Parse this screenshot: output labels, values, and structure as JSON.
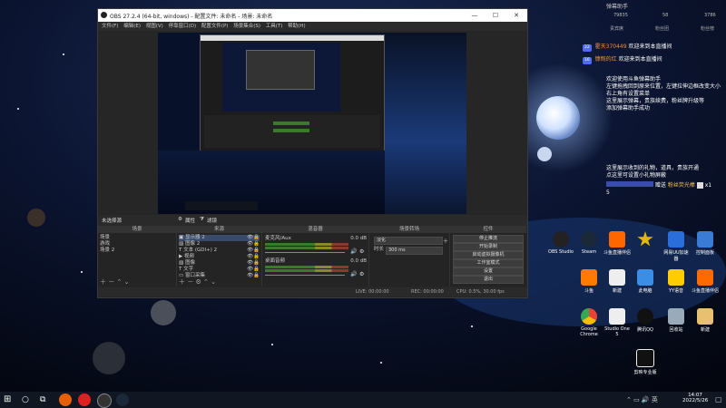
{
  "obs": {
    "title": "OBS 27.2.4 (64-bit, windows) - 配置文件: 未命名 - 场景: 未命名",
    "menu": [
      "文件(F)",
      "编辑(E)",
      "视图(V)",
      "停靠窗口(D)",
      "配置文件(P)",
      "场景集合(S)",
      "工具(T)",
      "帮助(H)"
    ],
    "scene_bar_label": "未选择源",
    "props_button": "属性",
    "filters_button": "滤镜",
    "docks": {
      "scenes": {
        "title": "场景",
        "items": [
          "场景",
          "游戏",
          "场景 2"
        ]
      },
      "sources": {
        "title": "来源",
        "items": [
          "显示器 2",
          "图像 2",
          "文本 (GDI+) 2",
          "视频",
          "图像",
          "文字",
          "窗口采集"
        ]
      },
      "mixer": {
        "title": "混音器",
        "channels": [
          {
            "name": "麦克风/Aux",
            "db": "0.0 dB"
          },
          {
            "name": "桌面音频",
            "db": "0.0 dB"
          }
        ]
      },
      "transitions": {
        "title": "场景转场",
        "type": "淡化",
        "duration_label": "时长",
        "duration_value": "300 ms"
      },
      "controls": {
        "title": "控件",
        "buttons": [
          "停止推流",
          "开始录制",
          "启动虚拟摄像机",
          "工作室模式",
          "设置",
          "退出"
        ]
      }
    },
    "status": {
      "live": "LIVE: 00:00:00",
      "rec": "REC: 00:00:00",
      "cpu": "CPU: 0.5%, 30.00 fps"
    }
  },
  "chat": {
    "stats": [
      "79835",
      "58",
      "3786"
    ],
    "tabs": [
      "贵宾席",
      "粉丝团",
      "粉丝榜"
    ],
    "welcome": [
      {
        "badge": "22",
        "name": "霍天370449",
        "text": "欢迎来到本直播间"
      },
      {
        "badge": "16",
        "name": "慷慨的红",
        "text": "欢迎来到本直播间"
      }
    ],
    "help_lines": [
      "欢迎使用斗鱼弹幕助手",
      "左键拖拽回到原来位置，左键拉伸边框改变大小",
      "右上角有设置菜单",
      "这里展示弹幕，贵族续费，粉丝牌升级等",
      "添加弹幕助手成功"
    ],
    "gift_lines": [
      "这里展示收到的礼物，道具，贵族开通",
      "点这里可设置小礼物屏蔽"
    ],
    "gift_item": {
      "user": "赠送",
      "gift": "粉丝荧光棒",
      "count": "x1"
    },
    "gift_number": "5"
  },
  "desktop_icons": [
    {
      "label": "OBS Studio",
      "color": "#222"
    },
    {
      "label": "Steam",
      "color": "#1b2838"
    },
    {
      "label": "斗鱼直播伴侣",
      "color": "#f60"
    },
    {
      "label": "",
      "color": "#e5b800"
    },
    {
      "label": "网易UU加速器",
      "color": "#2a6edb"
    },
    {
      "label": "控制面板",
      "color": "#3a7bd5"
    },
    {
      "label": "斗鱼",
      "color": "#ff7a00"
    },
    {
      "label": "新建",
      "color": "#eee"
    },
    {
      "label": "此电脑",
      "color": "#3a8ee6"
    },
    {
      "label": "YY语音",
      "color": "#ffcc00"
    },
    {
      "label": "斗鱼直播伴侣",
      "color": "#ff6a00"
    },
    {
      "label": "Google Chrome",
      "color": "#ea4335"
    },
    {
      "label": "Studio One 5",
      "color": "#eee"
    },
    {
      "label": "腾讯QQ",
      "color": "#111"
    },
    {
      "label": "回收站",
      "color": "#9ab"
    },
    {
      "label": "新建",
      "color": "#e8c070"
    },
    {
      "label": "剪映专业版",
      "color": "#111"
    }
  ],
  "taskbar": {
    "time": "14:07",
    "date": "2022/5/26"
  }
}
